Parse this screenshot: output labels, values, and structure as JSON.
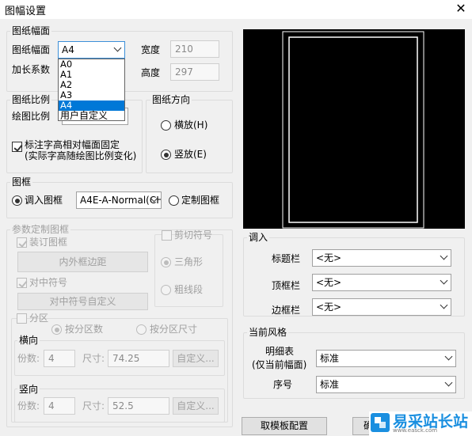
{
  "window": {
    "title": "图幅设置",
    "close_glyph": "✕"
  },
  "paper_size": {
    "group_title": "图纸幅面",
    "size_label": "图纸幅面",
    "size_value": "A4",
    "size_options": [
      "A0",
      "A1",
      "A2",
      "A3",
      "A4",
      "用户自定义"
    ],
    "selected_option": "A4",
    "scale_factor_label": "加长系数",
    "width_label": "宽度",
    "width_value": "210",
    "height_label": "高度",
    "height_value": "297"
  },
  "scale": {
    "group_title": "图纸比例",
    "drawing_scale_label": "绘图比例",
    "fix_text_label_line1": "标注字高相对幅面固定",
    "fix_text_label_line2": "(实际字高随绘图比例变化)",
    "fix_text_checked": true
  },
  "orientation": {
    "group_title": "图纸方向",
    "landscape_label": "横放(H)",
    "portrait_label": "竖放(E)",
    "selected": "portrait"
  },
  "frame": {
    "group_title": "图框",
    "import_label": "调入图框",
    "import_selected": true,
    "frame_value": "A4E-A-Normal(CH",
    "custom_label": "定制图框"
  },
  "param_frame": {
    "group_title": "参数定制图框",
    "binding_label": "装订图框",
    "binding_checked": true,
    "margin_button": "内外框边距",
    "center_mark_label": "对中符号",
    "center_mark_checked": true,
    "center_mark_button": "对中符号自定义",
    "cut_mark_label": "剪切符号",
    "triangle_label": "三角形",
    "thick_line_label": "粗线段",
    "partition_label": "分区",
    "by_count_label": "按分区数",
    "by_size_label": "按分区尺寸",
    "horizontal_title": "横向",
    "h_count_label": "份数:",
    "h_count_value": "4",
    "h_size_label": "尺寸:",
    "h_size_value": "74.25",
    "h_custom_button": "自定义...",
    "vertical_title": "竖向",
    "v_count_label": "份数:",
    "v_count_value": "4",
    "v_size_label": "尺寸:",
    "v_size_value": "52.5",
    "v_custom_button": "自定义..."
  },
  "import": {
    "group_title": "调入",
    "title_bar_label": "标题栏",
    "title_bar_value": "<无>",
    "top_bar_label": "顶框栏",
    "top_bar_value": "<无>",
    "side_bar_label": "边框栏",
    "side_bar_value": "<无>"
  },
  "style": {
    "group_title": "当前风格",
    "detail_label_line1": "明细表",
    "detail_label_line2": "(仅当前幅面)",
    "detail_value": "标准",
    "serial_label": "序号",
    "serial_value": "标准"
  },
  "buttons": {
    "template_config": "取模板配置",
    "ok_partial": "确"
  },
  "watermark": {
    "text": "易采站长站",
    "subtext": "www.easck.com"
  },
  "colors": {
    "selection_blue": "#0078d7",
    "preview_bg": "#000000",
    "preview_lines": "#ffffff",
    "watermark_blue": "#1a8fe0"
  }
}
